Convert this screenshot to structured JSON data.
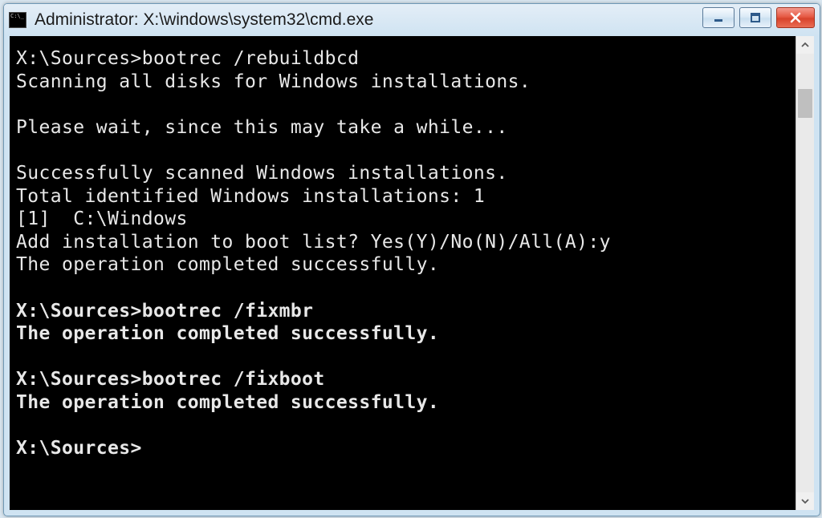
{
  "window": {
    "title": "Administrator: X:\\windows\\system32\\cmd.exe"
  },
  "console": {
    "lines": [
      {
        "text": "X:\\Sources>bootrec /rebuildbcd",
        "bold": false
      },
      {
        "text": "Scanning all disks for Windows installations.",
        "bold": false
      },
      {
        "text": "",
        "bold": false
      },
      {
        "text": "Please wait, since this may take a while...",
        "bold": false
      },
      {
        "text": "",
        "bold": false
      },
      {
        "text": "Successfully scanned Windows installations.",
        "bold": false
      },
      {
        "text": "Total identified Windows installations: 1",
        "bold": false
      },
      {
        "text": "[1]  C:\\Windows",
        "bold": false
      },
      {
        "text": "Add installation to boot list? Yes(Y)/No(N)/All(A):y",
        "bold": false
      },
      {
        "text": "The operation completed successfully.",
        "bold": false
      },
      {
        "text": "",
        "bold": false
      },
      {
        "text": "X:\\Sources>bootrec /fixmbr",
        "bold": true
      },
      {
        "text": "The operation completed successfully.",
        "bold": true
      },
      {
        "text": "",
        "bold": false
      },
      {
        "text": "X:\\Sources>bootrec /fixboot",
        "bold": true
      },
      {
        "text": "The operation completed successfully.",
        "bold": true
      },
      {
        "text": "",
        "bold": false
      },
      {
        "text": "X:\\Sources>",
        "bold": true
      }
    ]
  }
}
